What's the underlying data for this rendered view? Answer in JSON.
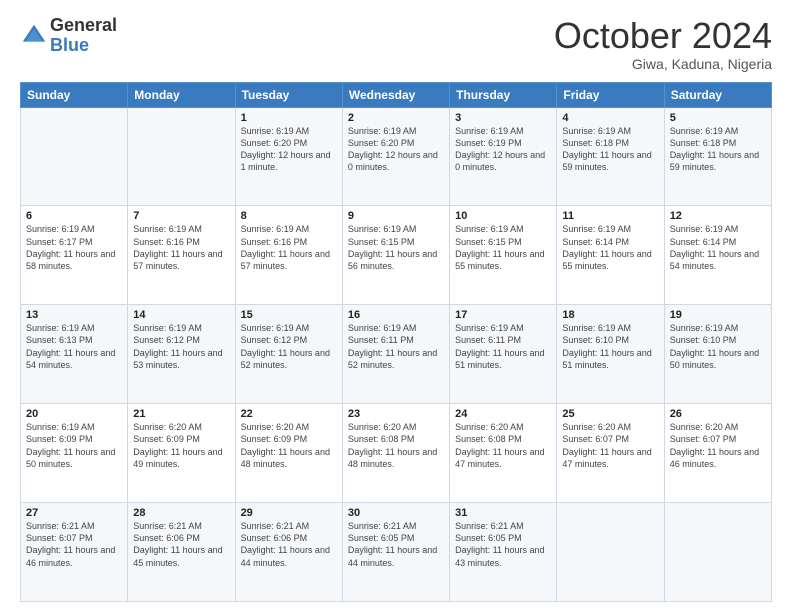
{
  "header": {
    "logo_line1": "General",
    "logo_line2": "Blue",
    "month": "October 2024",
    "location": "Giwa, Kaduna, Nigeria"
  },
  "days_of_week": [
    "Sunday",
    "Monday",
    "Tuesday",
    "Wednesday",
    "Thursday",
    "Friday",
    "Saturday"
  ],
  "weeks": [
    [
      {
        "day": "",
        "sunrise": "",
        "sunset": "",
        "daylight": ""
      },
      {
        "day": "",
        "sunrise": "",
        "sunset": "",
        "daylight": ""
      },
      {
        "day": "1",
        "sunrise": "Sunrise: 6:19 AM",
        "sunset": "Sunset: 6:20 PM",
        "daylight": "Daylight: 12 hours and 1 minute."
      },
      {
        "day": "2",
        "sunrise": "Sunrise: 6:19 AM",
        "sunset": "Sunset: 6:20 PM",
        "daylight": "Daylight: 12 hours and 0 minutes."
      },
      {
        "day": "3",
        "sunrise": "Sunrise: 6:19 AM",
        "sunset": "Sunset: 6:19 PM",
        "daylight": "Daylight: 12 hours and 0 minutes."
      },
      {
        "day": "4",
        "sunrise": "Sunrise: 6:19 AM",
        "sunset": "Sunset: 6:18 PM",
        "daylight": "Daylight: 11 hours and 59 minutes."
      },
      {
        "day": "5",
        "sunrise": "Sunrise: 6:19 AM",
        "sunset": "Sunset: 6:18 PM",
        "daylight": "Daylight: 11 hours and 59 minutes."
      }
    ],
    [
      {
        "day": "6",
        "sunrise": "Sunrise: 6:19 AM",
        "sunset": "Sunset: 6:17 PM",
        "daylight": "Daylight: 11 hours and 58 minutes."
      },
      {
        "day": "7",
        "sunrise": "Sunrise: 6:19 AM",
        "sunset": "Sunset: 6:16 PM",
        "daylight": "Daylight: 11 hours and 57 minutes."
      },
      {
        "day": "8",
        "sunrise": "Sunrise: 6:19 AM",
        "sunset": "Sunset: 6:16 PM",
        "daylight": "Daylight: 11 hours and 57 minutes."
      },
      {
        "day": "9",
        "sunrise": "Sunrise: 6:19 AM",
        "sunset": "Sunset: 6:15 PM",
        "daylight": "Daylight: 11 hours and 56 minutes."
      },
      {
        "day": "10",
        "sunrise": "Sunrise: 6:19 AM",
        "sunset": "Sunset: 6:15 PM",
        "daylight": "Daylight: 11 hours and 55 minutes."
      },
      {
        "day": "11",
        "sunrise": "Sunrise: 6:19 AM",
        "sunset": "Sunset: 6:14 PM",
        "daylight": "Daylight: 11 hours and 55 minutes."
      },
      {
        "day": "12",
        "sunrise": "Sunrise: 6:19 AM",
        "sunset": "Sunset: 6:14 PM",
        "daylight": "Daylight: 11 hours and 54 minutes."
      }
    ],
    [
      {
        "day": "13",
        "sunrise": "Sunrise: 6:19 AM",
        "sunset": "Sunset: 6:13 PM",
        "daylight": "Daylight: 11 hours and 54 minutes."
      },
      {
        "day": "14",
        "sunrise": "Sunrise: 6:19 AM",
        "sunset": "Sunset: 6:12 PM",
        "daylight": "Daylight: 11 hours and 53 minutes."
      },
      {
        "day": "15",
        "sunrise": "Sunrise: 6:19 AM",
        "sunset": "Sunset: 6:12 PM",
        "daylight": "Daylight: 11 hours and 52 minutes."
      },
      {
        "day": "16",
        "sunrise": "Sunrise: 6:19 AM",
        "sunset": "Sunset: 6:11 PM",
        "daylight": "Daylight: 11 hours and 52 minutes."
      },
      {
        "day": "17",
        "sunrise": "Sunrise: 6:19 AM",
        "sunset": "Sunset: 6:11 PM",
        "daylight": "Daylight: 11 hours and 51 minutes."
      },
      {
        "day": "18",
        "sunrise": "Sunrise: 6:19 AM",
        "sunset": "Sunset: 6:10 PM",
        "daylight": "Daylight: 11 hours and 51 minutes."
      },
      {
        "day": "19",
        "sunrise": "Sunrise: 6:19 AM",
        "sunset": "Sunset: 6:10 PM",
        "daylight": "Daylight: 11 hours and 50 minutes."
      }
    ],
    [
      {
        "day": "20",
        "sunrise": "Sunrise: 6:19 AM",
        "sunset": "Sunset: 6:09 PM",
        "daylight": "Daylight: 11 hours and 50 minutes."
      },
      {
        "day": "21",
        "sunrise": "Sunrise: 6:20 AM",
        "sunset": "Sunset: 6:09 PM",
        "daylight": "Daylight: 11 hours and 49 minutes."
      },
      {
        "day": "22",
        "sunrise": "Sunrise: 6:20 AM",
        "sunset": "Sunset: 6:09 PM",
        "daylight": "Daylight: 11 hours and 48 minutes."
      },
      {
        "day": "23",
        "sunrise": "Sunrise: 6:20 AM",
        "sunset": "Sunset: 6:08 PM",
        "daylight": "Daylight: 11 hours and 48 minutes."
      },
      {
        "day": "24",
        "sunrise": "Sunrise: 6:20 AM",
        "sunset": "Sunset: 6:08 PM",
        "daylight": "Daylight: 11 hours and 47 minutes."
      },
      {
        "day": "25",
        "sunrise": "Sunrise: 6:20 AM",
        "sunset": "Sunset: 6:07 PM",
        "daylight": "Daylight: 11 hours and 47 minutes."
      },
      {
        "day": "26",
        "sunrise": "Sunrise: 6:20 AM",
        "sunset": "Sunset: 6:07 PM",
        "daylight": "Daylight: 11 hours and 46 minutes."
      }
    ],
    [
      {
        "day": "27",
        "sunrise": "Sunrise: 6:21 AM",
        "sunset": "Sunset: 6:07 PM",
        "daylight": "Daylight: 11 hours and 46 minutes."
      },
      {
        "day": "28",
        "sunrise": "Sunrise: 6:21 AM",
        "sunset": "Sunset: 6:06 PM",
        "daylight": "Daylight: 11 hours and 45 minutes."
      },
      {
        "day": "29",
        "sunrise": "Sunrise: 6:21 AM",
        "sunset": "Sunset: 6:06 PM",
        "daylight": "Daylight: 11 hours and 44 minutes."
      },
      {
        "day": "30",
        "sunrise": "Sunrise: 6:21 AM",
        "sunset": "Sunset: 6:05 PM",
        "daylight": "Daylight: 11 hours and 44 minutes."
      },
      {
        "day": "31",
        "sunrise": "Sunrise: 6:21 AM",
        "sunset": "Sunset: 6:05 PM",
        "daylight": "Daylight: 11 hours and 43 minutes."
      },
      {
        "day": "",
        "sunrise": "",
        "sunset": "",
        "daylight": ""
      },
      {
        "day": "",
        "sunrise": "",
        "sunset": "",
        "daylight": ""
      }
    ]
  ]
}
